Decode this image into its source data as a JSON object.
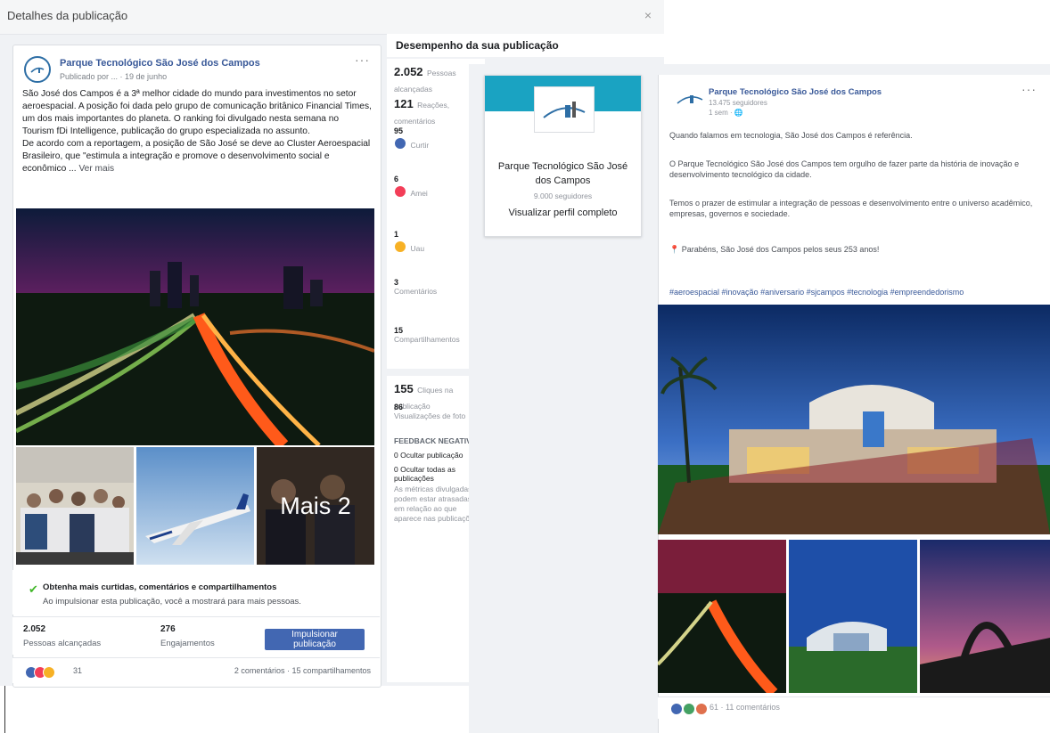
{
  "dialog": {
    "title": "Detalhes da publicação",
    "close_glyph": "×"
  },
  "post": {
    "page_name": "Parque Tecnológico São José dos Campos",
    "published_meta": "Publicado por ... · 19 de junho",
    "menu_glyph": "···",
    "text_para1": "São José dos Campos é a 3ª melhor cidade do mundo para investimentos no setor aeroespacial. A posição foi dada pelo grupo de comunicação britânico Financial Times, um dos mais importantes do planeta. O ranking foi divulgado nesta semana no Tourism fDi Intelligence, publicação do grupo especializada no assunto.",
    "text_para2": "De acordo com a reportagem, a posição de São José se deve ao Cluster Aeroespacial Brasileiro, que \"estimula a integração e promove o desenvolvimento social e econômico ...",
    "see_more": "Ver mais",
    "more_label": "Mais 2"
  },
  "boost_tip": {
    "title": "Obtenha mais curtidas, comentários e compartilhamentos",
    "subtitle": "Ao impulsionar esta publicação, você a mostrará para mais pessoas."
  },
  "stats": {
    "reach_value": "2.052",
    "reach_label": "Pessoas alcançadas",
    "engagement_value": "276",
    "engagement_label": "Engajamentos",
    "boost_button": "Impulsionar publicação"
  },
  "reactions": {
    "count": "31",
    "comments_shares": "2 comentários · 15 compartilhamentos"
  },
  "performance": {
    "title": "Desempenho da sua publicação",
    "reach_value": "2.052",
    "reach_label": "Pessoas alcançadas",
    "reactions_value": "121",
    "reactions_label": "Reações, comentários",
    "likes_value": "95",
    "likes_label": "Curtir",
    "love_value": "6",
    "love_label": "Amei",
    "wow_value": "1",
    "wow_label": "Uau",
    "comments_value": "3",
    "comments_label": "Comentários",
    "shares_value": "15",
    "shares_label": "Compartilhamentos",
    "clicks_value": "155",
    "clicks_label": "Cliques na publicação",
    "photo_views_value": "86",
    "photo_views_label": "Visualizações de foto",
    "negative_title": "FEEDBACK NEGATIVO",
    "hide_post_label": "0 Ocultar publicação",
    "hide_all_label": "0 Ocultar todas as publicações",
    "footnote": "As métricas divulgadas podem estar atrasadas em relação ao que aparece nas publicações."
  },
  "profile_card": {
    "name": "Parque Tecnológico São José dos Campos",
    "followers": "9.000 seguidores",
    "view_full": "Visualizar perfil completo"
  },
  "right_post": {
    "page_name": "Parque Tecnológico São José dos Campos",
    "meta1": "13.475 seguidores",
    "meta2": "1 sem · 🌐",
    "menu_glyph": "···",
    "p1": "Quando falamos em tecnologia, São José dos Campos é referência.",
    "p2": "O Parque Tecnológico São José dos Campos tem orgulho de fazer parte da história de inovação e desenvolvimento tecnológico da cidade.",
    "p3": "Temos o prazer de estimular a integração de pessoas e desenvolvimento entre o universo acadêmico, empresas, governos e sociedade.",
    "p4": "📍 Parabéns, São José dos Campos pelos seus 253 anos!",
    "hashtags": "#aeroespacial #inovação #aniversario #sjcampos #tecnologia #empreendedorismo",
    "reaction_count": "61 · 11 comentários"
  },
  "colors": {
    "facebook_blue": "#4267b2",
    "link_blue": "#385898",
    "profile_cover": "#1aa3c2",
    "check_green": "#42b72a",
    "background": "#f0f2f5"
  },
  "icons": {
    "check": "check-icon",
    "like": "like-icon",
    "love": "love-icon",
    "wow": "wow-icon",
    "close": "close-icon",
    "menu": "more-options-icon"
  }
}
